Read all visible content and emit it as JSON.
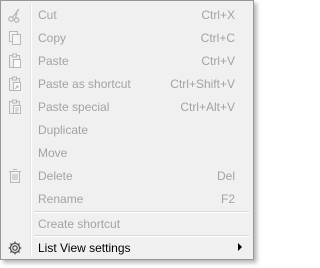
{
  "menu": {
    "items": [
      {
        "label": "Cut",
        "shortcut": "Ctrl+X",
        "icon": "scissors-icon",
        "enabled": false
      },
      {
        "label": "Copy",
        "shortcut": "Ctrl+C",
        "icon": "copy-icon",
        "enabled": false
      },
      {
        "label": "Paste",
        "shortcut": "Ctrl+V",
        "icon": "paste-icon",
        "enabled": false
      },
      {
        "label": "Paste as shortcut",
        "shortcut": "Ctrl+Shift+V",
        "icon": "paste-shortcut-icon",
        "enabled": false
      },
      {
        "label": "Paste special",
        "shortcut": "Ctrl+Alt+V",
        "icon": "paste-special-icon",
        "enabled": false
      },
      {
        "label": "Duplicate",
        "shortcut": "",
        "icon": "",
        "enabled": false
      },
      {
        "label": "Move",
        "shortcut": "",
        "icon": "",
        "enabled": false
      },
      {
        "label": "Delete",
        "shortcut": "Del",
        "icon": "trash-icon",
        "enabled": false
      },
      {
        "label": "Rename",
        "shortcut": "F2",
        "icon": "",
        "enabled": false
      },
      {
        "label": "Create shortcut",
        "shortcut": "",
        "icon": "",
        "enabled": false
      },
      {
        "label": "List View settings",
        "shortcut": "",
        "icon": "gear-icon",
        "enabled": true,
        "submenu": true
      }
    ]
  },
  "colors": {
    "disabled_text": "#a3a3a3",
    "enabled_text": "#000000",
    "background": "#f0f0f0",
    "border": "#979797"
  }
}
